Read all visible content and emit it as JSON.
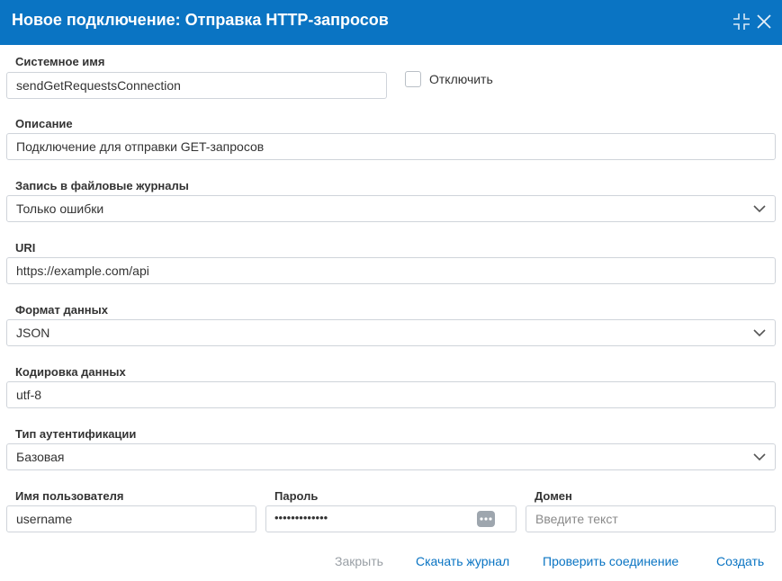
{
  "dialog": {
    "title": "Новое подключение: Отправка HTTP-запросов",
    "icons": {
      "collapse": "collapse-icon",
      "close": "close-icon"
    }
  },
  "form": {
    "system_name": {
      "label": "Системное имя",
      "value": "sendGetRequestsConnection"
    },
    "disable": {
      "label": "Отключить",
      "checked": false
    },
    "description": {
      "label": "Описание",
      "value": "Подключение для отправки GET-запросов"
    },
    "file_logging": {
      "label": "Запись в файловые журналы",
      "value": "Только ошибки"
    },
    "uri": {
      "label": "URI",
      "value": "https://example.com/api"
    },
    "data_format": {
      "label": "Формат данных",
      "value": "JSON"
    },
    "data_encoding": {
      "label": "Кодировка данных",
      "value": "utf-8"
    },
    "auth_type": {
      "label": "Тип аутентификации",
      "value": "Базовая"
    },
    "username": {
      "label": "Имя пользователя",
      "value": "username"
    },
    "password": {
      "label": "Пароль",
      "masked": "•••••••••••••"
    },
    "domain": {
      "label": "Домен",
      "placeholder": "Введите текст"
    }
  },
  "actions": {
    "close": "Закрыть",
    "download_log": "Скачать журнал",
    "test_connection": "Проверить соединение",
    "create": "Создать"
  },
  "colors": {
    "accent": "#0a74c3",
    "disabled": "#9aa0a6",
    "border": "#cfd4da"
  }
}
